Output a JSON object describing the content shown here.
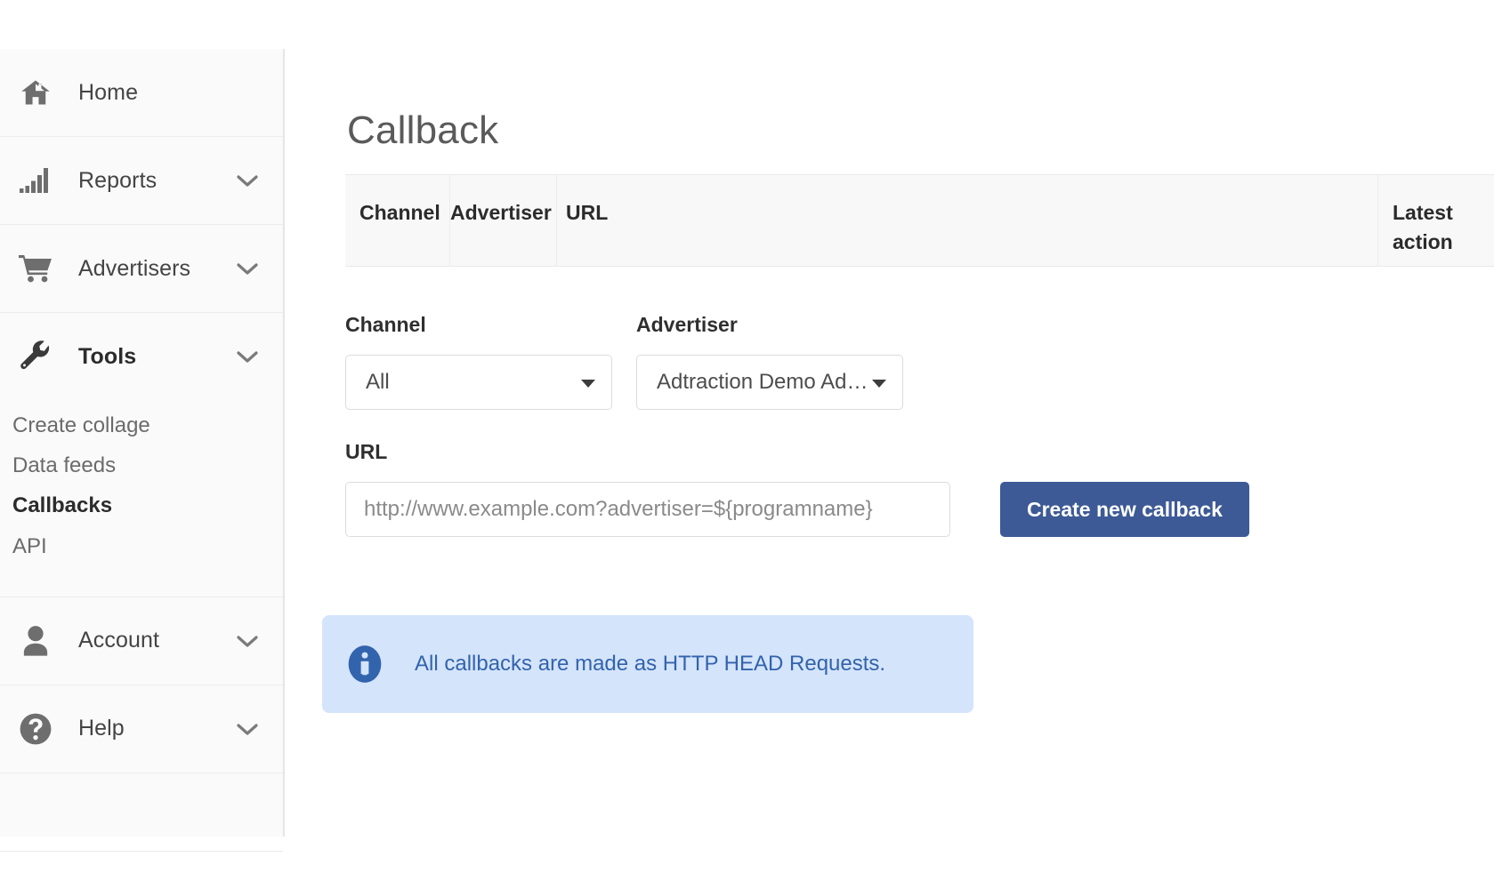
{
  "sidebar": {
    "items": [
      {
        "label": "Home",
        "icon": "home-icon",
        "has_chevron": false,
        "active": false
      },
      {
        "label": "Reports",
        "icon": "bar-chart-icon",
        "has_chevron": true,
        "active": false
      },
      {
        "label": "Advertisers",
        "icon": "shopping-cart-icon",
        "has_chevron": true,
        "active": false
      },
      {
        "label": "Tools",
        "icon": "wrench-icon",
        "has_chevron": true,
        "active": true
      },
      {
        "label": "Account",
        "icon": "user-icon",
        "has_chevron": true,
        "active": false
      },
      {
        "label": "Help",
        "icon": "question-circle-icon",
        "has_chevron": true,
        "active": false
      }
    ],
    "tools_subitems": [
      {
        "label": "Create collage",
        "active": false
      },
      {
        "label": "Data feeds",
        "active": false
      },
      {
        "label": "Callbacks",
        "active": true
      },
      {
        "label": "API",
        "active": false
      }
    ]
  },
  "main": {
    "page_title": "Callback",
    "table": {
      "columns": [
        "Channel",
        "Advertiser",
        "URL",
        "Latest action"
      ],
      "rows": []
    },
    "form": {
      "channel": {
        "label": "Channel",
        "value": "All"
      },
      "advertiser": {
        "label": "Advertiser",
        "value": "Adtraction Demo Ad…"
      },
      "url": {
        "label": "URL",
        "value": "",
        "placeholder": "http://www.example.com?advertiser=${programname}"
      },
      "submit_label": "Create new callback"
    },
    "alert": {
      "icon": "info-circle-icon",
      "text": "All callbacks are made as HTTP HEAD Requests."
    }
  },
  "colors": {
    "primary_button": "#3d5a96",
    "alert_background": "#d4e4fa",
    "alert_text": "#3263ad",
    "sidebar_background": "#fafafa",
    "table_header_background": "#f8f8f9"
  }
}
